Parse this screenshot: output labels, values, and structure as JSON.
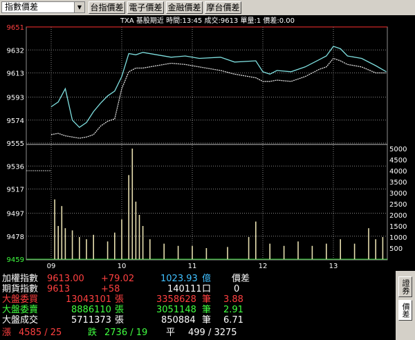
{
  "toolbar": {
    "select_value": "指數價差",
    "buttons": [
      "台指價差",
      "電子價差",
      "金融價差",
      "摩台價差"
    ]
  },
  "chart_header": "TXA  基股期近 時間:13:45 成交:9613 單量:1  價差:0.00",
  "chart_data": {
    "type": "line",
    "price_axis_ticks": [
      "9651",
      "9632",
      "9613",
      "9593",
      "9574",
      "9555",
      "9536",
      "9517",
      "9497",
      "9478",
      "9459"
    ],
    "volume_axis_ticks": [
      "5000",
      "4500",
      "4000",
      "3500",
      "3000",
      "2500",
      "2000",
      "1500",
      "1000",
      "500"
    ],
    "x_ticks": [
      "09",
      "10",
      "11",
      "12",
      "13"
    ],
    "series": [
      {
        "color": "#7fe0e0",
        "x": [
          9.0,
          9.1,
          9.2,
          9.3,
          9.4,
          9.5,
          9.6,
          9.7,
          9.8,
          9.9,
          10.0,
          10.1,
          10.2,
          10.3,
          10.5,
          10.7,
          10.9,
          11.1,
          11.4,
          11.6,
          11.9,
          12.0,
          12.1,
          12.2,
          12.4,
          12.6,
          12.8,
          12.9,
          13.0,
          13.1,
          13.2,
          13.4,
          13.6,
          13.75
        ],
        "y": [
          9585,
          9589,
          9600,
          9574,
          9568,
          9572,
          9581,
          9588,
          9594,
          9598,
          9610,
          9629,
          9628,
          9630,
          9628,
          9626,
          9627,
          9625,
          9626,
          9622,
          9623,
          9614,
          9612,
          9615,
          9614,
          9618,
          9624,
          9627,
          9635,
          9633,
          9627,
          9625,
          9619,
          9614
        ]
      },
      {
        "color": "#e0e0e0",
        "x": [
          9.0,
          9.1,
          9.2,
          9.3,
          9.4,
          9.5,
          9.6,
          9.7,
          9.8,
          9.9,
          10.0,
          10.1,
          10.2,
          10.3,
          10.5,
          10.7,
          10.9,
          11.1,
          11.4,
          11.6,
          11.9,
          12.0,
          12.1,
          12.2,
          12.4,
          12.6,
          12.8,
          12.9,
          13.0,
          13.1,
          13.2,
          13.4,
          13.6,
          13.75
        ],
        "y": [
          9562,
          9563,
          9561,
          9560,
          9559,
          9560,
          9562,
          9569,
          9573,
          9575,
          9600,
          9614,
          9617,
          9617,
          9619,
          9621,
          9620,
          9618,
          9615,
          9612,
          9609,
          9606,
          9606,
          9607,
          9606,
          9610,
          9616,
          9618,
          9625,
          9623,
          9620,
          9618,
          9613,
          9613
        ]
      }
    ],
    "volume": [
      {
        "x": 9.05,
        "v": 2700
      },
      {
        "x": 9.1,
        "v": 1500
      },
      {
        "x": 9.15,
        "v": 2400
      },
      {
        "x": 9.2,
        "v": 1400
      },
      {
        "x": 9.3,
        "v": 1300
      },
      {
        "x": 9.4,
        "v": 1000
      },
      {
        "x": 9.5,
        "v": 900
      },
      {
        "x": 9.6,
        "v": 1100
      },
      {
        "x": 9.8,
        "v": 800
      },
      {
        "x": 9.9,
        "v": 1200
      },
      {
        "x": 10.0,
        "v": 1800
      },
      {
        "x": 10.1,
        "v": 3800
      },
      {
        "x": 10.15,
        "v": 5000
      },
      {
        "x": 10.2,
        "v": 2600
      },
      {
        "x": 10.25,
        "v": 2000
      },
      {
        "x": 10.3,
        "v": 1500
      },
      {
        "x": 10.4,
        "v": 900
      },
      {
        "x": 10.6,
        "v": 700
      },
      {
        "x": 10.8,
        "v": 600
      },
      {
        "x": 11.0,
        "v": 600
      },
      {
        "x": 11.2,
        "v": 500
      },
      {
        "x": 11.5,
        "v": 550
      },
      {
        "x": 11.8,
        "v": 1000
      },
      {
        "x": 11.9,
        "v": 1700
      },
      {
        "x": 12.1,
        "v": 700
      },
      {
        "x": 12.3,
        "v": 600
      },
      {
        "x": 12.5,
        "v": 800
      },
      {
        "x": 12.7,
        "v": 600
      },
      {
        "x": 12.9,
        "v": 700
      },
      {
        "x": 13.1,
        "v": 900
      },
      {
        "x": 13.3,
        "v": 700
      },
      {
        "x": 13.5,
        "v": 1400
      },
      {
        "x": 13.6,
        "v": 900
      },
      {
        "x": 13.7,
        "v": 1000
      }
    ]
  },
  "quotes": {
    "row1": {
      "label": "加權指數",
      "price": "9613.00",
      "change": "+79.02",
      "amount": "1023.93",
      "unit": "億",
      "extra_label": "價差"
    },
    "row2": {
      "label": "期貨指數",
      "price": "9613",
      "change": "+58",
      "qty": "140111",
      "unit": "口",
      "extra": "0"
    },
    "row3": {
      "label": "大盤委買",
      "value": "13043101",
      "unit": "張",
      "count": "3358628",
      "count_unit": "筆",
      "ratio": "3.88"
    },
    "row4": {
      "label": "大盤委賣",
      "value": "8886110",
      "unit": "張",
      "count": "3051148",
      "count_unit": "筆",
      "ratio": "2.91"
    },
    "row5": {
      "label": "大盤成交",
      "value": "5711373",
      "unit": "張",
      "count": "850884",
      "count_unit": "筆",
      "ratio": "6.71"
    },
    "row6": {
      "up_label": "漲",
      "up_value": "4585 / 25",
      "down_label": "跌",
      "down_value": "2736 / 19",
      "flat_label": "平",
      "flat_value": "499 / 3275"
    }
  },
  "side_tabs": [
    "證券",
    "價差"
  ],
  "colors": {
    "up": "#ff4040",
    "down": "#40ff40",
    "neutral": "#ffffff",
    "accent": "#40c0ff"
  }
}
